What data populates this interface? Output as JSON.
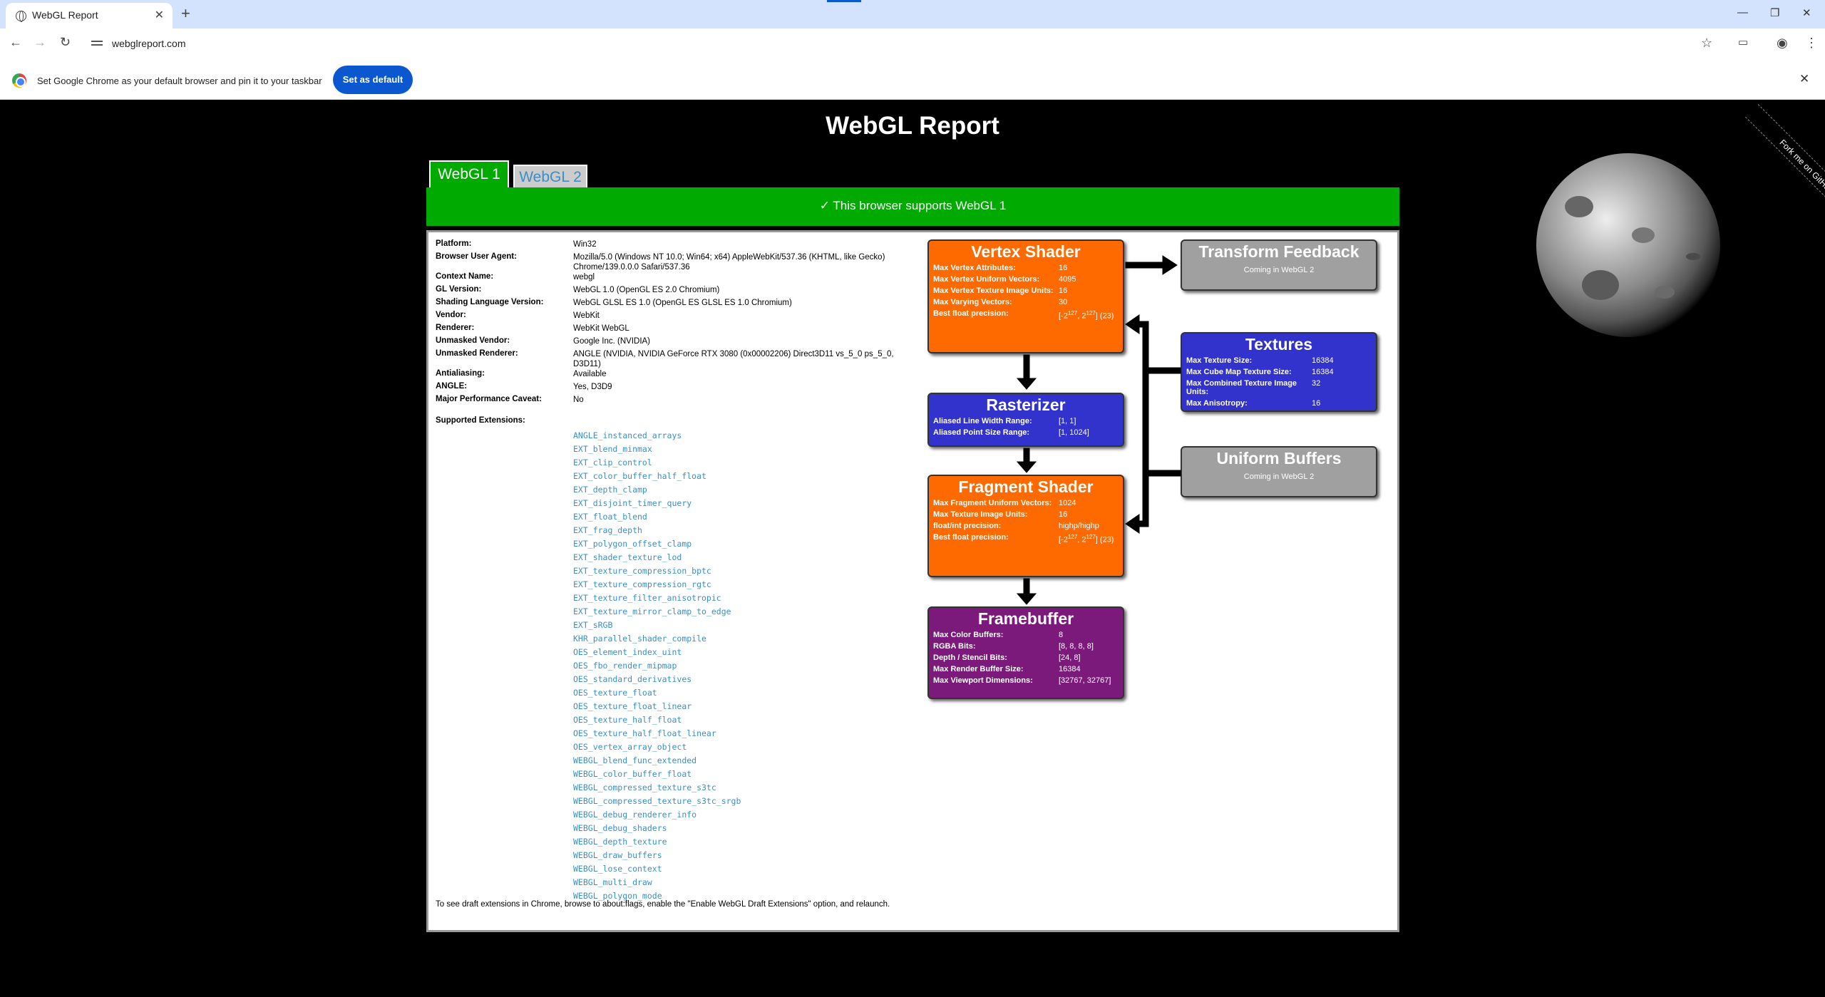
{
  "browser": {
    "tab_title": "WebGL Report",
    "url": "webglreport.com",
    "infobar_text": "Set Google Chrome as your default browser and pin it to your taskbar",
    "set_default_label": "Set as default"
  },
  "page": {
    "title": "WebGL Report",
    "fork_label": "Fork me on GitHub",
    "tabs": [
      "WebGL 1",
      "WebGL 2"
    ],
    "support_message": "✓ This browser supports WebGL 1",
    "info": [
      {
        "k": "Platform:",
        "v": "Win32"
      },
      {
        "k": "Browser User Agent:",
        "v": "Mozilla/5.0 (Windows NT 10.0; Win64; x64) AppleWebKit/537.36 (KHTML, like Gecko) Chrome/139.0.0.0 Safari/537.36"
      },
      {
        "k": "Context Name:",
        "v": "webgl"
      },
      {
        "k": "GL Version:",
        "v": "WebGL 1.0 (OpenGL ES 2.0 Chromium)"
      },
      {
        "k": "Shading Language Version:",
        "v": "WebGL GLSL ES 1.0 (OpenGL ES GLSL ES 1.0 Chromium)"
      },
      {
        "k": "Vendor:",
        "v": "WebKit"
      },
      {
        "k": "Renderer:",
        "v": "WebKit WebGL"
      },
      {
        "k": "Unmasked Vendor:",
        "v": "Google Inc. (NVIDIA)"
      },
      {
        "k": "Unmasked Renderer:",
        "v": "ANGLE (NVIDIA, NVIDIA GeForce RTX 3080 (0x00002206) Direct3D11 vs_5_0 ps_5_0, D3D11)"
      },
      {
        "k": "Antialiasing:",
        "v": "Available"
      },
      {
        "k": "ANGLE:",
        "v": "Yes, D3D9"
      },
      {
        "k": "Major Performance Caveat:",
        "v": "No"
      }
    ],
    "extensions_label": "Supported Extensions:",
    "extensions": [
      "ANGLE_instanced_arrays",
      "EXT_blend_minmax",
      "EXT_clip_control",
      "EXT_color_buffer_half_float",
      "EXT_depth_clamp",
      "EXT_disjoint_timer_query",
      "EXT_float_blend",
      "EXT_frag_depth",
      "EXT_polygon_offset_clamp",
      "EXT_shader_texture_lod",
      "EXT_texture_compression_bptc",
      "EXT_texture_compression_rgtc",
      "EXT_texture_filter_anisotropic",
      "EXT_texture_mirror_clamp_to_edge",
      "EXT_sRGB",
      "KHR_parallel_shader_compile",
      "OES_element_index_uint",
      "OES_fbo_render_mipmap",
      "OES_standard_derivatives",
      "OES_texture_float",
      "OES_texture_float_linear",
      "OES_texture_half_float",
      "OES_texture_half_float_linear",
      "OES_vertex_array_object",
      "WEBGL_blend_func_extended",
      "WEBGL_color_buffer_float",
      "WEBGL_compressed_texture_s3tc",
      "WEBGL_compressed_texture_s3tc_srgb",
      "WEBGL_debug_renderer_info",
      "WEBGL_debug_shaders",
      "WEBGL_depth_texture",
      "WEBGL_draw_buffers",
      "WEBGL_lose_context",
      "WEBGL_multi_draw",
      "WEBGL_polygon_mode"
    ],
    "draft_note": "To see draft extensions in Chrome, browse to about:flags, enable the \"Enable WebGL Draft Extensions\" option, and relaunch."
  },
  "pipeline": {
    "vertex": {
      "title": "Vertex Shader",
      "rows": [
        {
          "k": "Max Vertex Attributes:",
          "v": "16"
        },
        {
          "k": "Max Vertex Uniform Vectors:",
          "v": "4095"
        },
        {
          "k": "Max Vertex Texture Image Units:",
          "v": "16"
        },
        {
          "k": "Max Varying Vectors:",
          "v": "30"
        },
        {
          "k": "Best float precision:",
          "v": "[-2^127, 2^127] (23)"
        }
      ]
    },
    "rasterizer": {
      "title": "Rasterizer",
      "rows": [
        {
          "k": "Aliased Line Width Range:",
          "v": "[1, 1]"
        },
        {
          "k": "Aliased Point Size Range:",
          "v": "[1, 1024]"
        }
      ]
    },
    "fragment": {
      "title": "Fragment Shader",
      "rows": [
        {
          "k": "Max Fragment Uniform Vectors:",
          "v": "1024"
        },
        {
          "k": "Max Texture Image Units:",
          "v": "16"
        },
        {
          "k": "float/int precision:",
          "v": "highp/highp"
        },
        {
          "k": "Best float precision:",
          "v": "[-2^127, 2^127] (23)"
        }
      ]
    },
    "framebuffer": {
      "title": "Framebuffer",
      "rows": [
        {
          "k": "Max Color Buffers:",
          "v": "8"
        },
        {
          "k": "RGBA Bits:",
          "v": "[8, 8, 8, 8]"
        },
        {
          "k": "Depth / Stencil Bits:",
          "v": "[24, 8]"
        },
        {
          "k": "Max Render Buffer Size:",
          "v": "16384"
        },
        {
          "k": "Max Viewport Dimensions:",
          "v": "[32767, 32767]"
        }
      ]
    },
    "transform": {
      "title": "Transform Feedback",
      "note": "Coming in WebGL 2"
    },
    "textures": {
      "title": "Textures",
      "rows": [
        {
          "k": "Max Texture Size:",
          "v": "16384"
        },
        {
          "k": "Max Cube Map Texture Size:",
          "v": "16384"
        },
        {
          "k": "Max Combined Texture Image Units:",
          "v": "32"
        },
        {
          "k": "Max Anisotropy:",
          "v": "16"
        }
      ]
    },
    "uniform": {
      "title": "Uniform Buffers",
      "note": "Coming in WebGL 2"
    }
  }
}
